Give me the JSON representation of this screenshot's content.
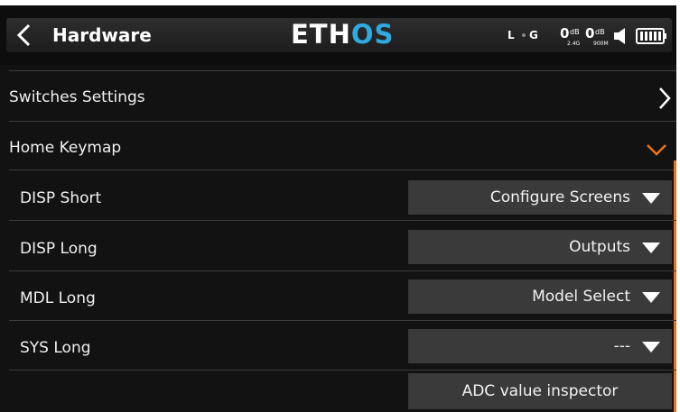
{
  "header": {
    "title": "Hardware",
    "logo_main": "ETH",
    "logo_accent": "OS",
    "status": {
      "receiver_letter": "L",
      "gps_letter": "G",
      "rssi_2g4": "0",
      "rssi_2g4_unit": "dB",
      "rssi_900": "0",
      "rssi_900_unit": "dB",
      "band_2g4": "2.4G",
      "band_900": "900M"
    }
  },
  "sections": {
    "switches_settings": "Switches Settings",
    "home_keymap": "Home Keymap"
  },
  "keymap_rows": [
    {
      "label": "DISP Short",
      "value": "Configure Screens"
    },
    {
      "label": "DISP Long",
      "value": "Outputs"
    },
    {
      "label": "MDL Long",
      "value": "Model Select"
    },
    {
      "label": "SYS Long",
      "value": "---"
    }
  ],
  "adc_button": "ADC value inspector",
  "colors": {
    "background": "#121212",
    "dropdown": "#3a3a3a",
    "accent_orange": "#e8741c",
    "logo_blue": "#2fa9e0"
  }
}
